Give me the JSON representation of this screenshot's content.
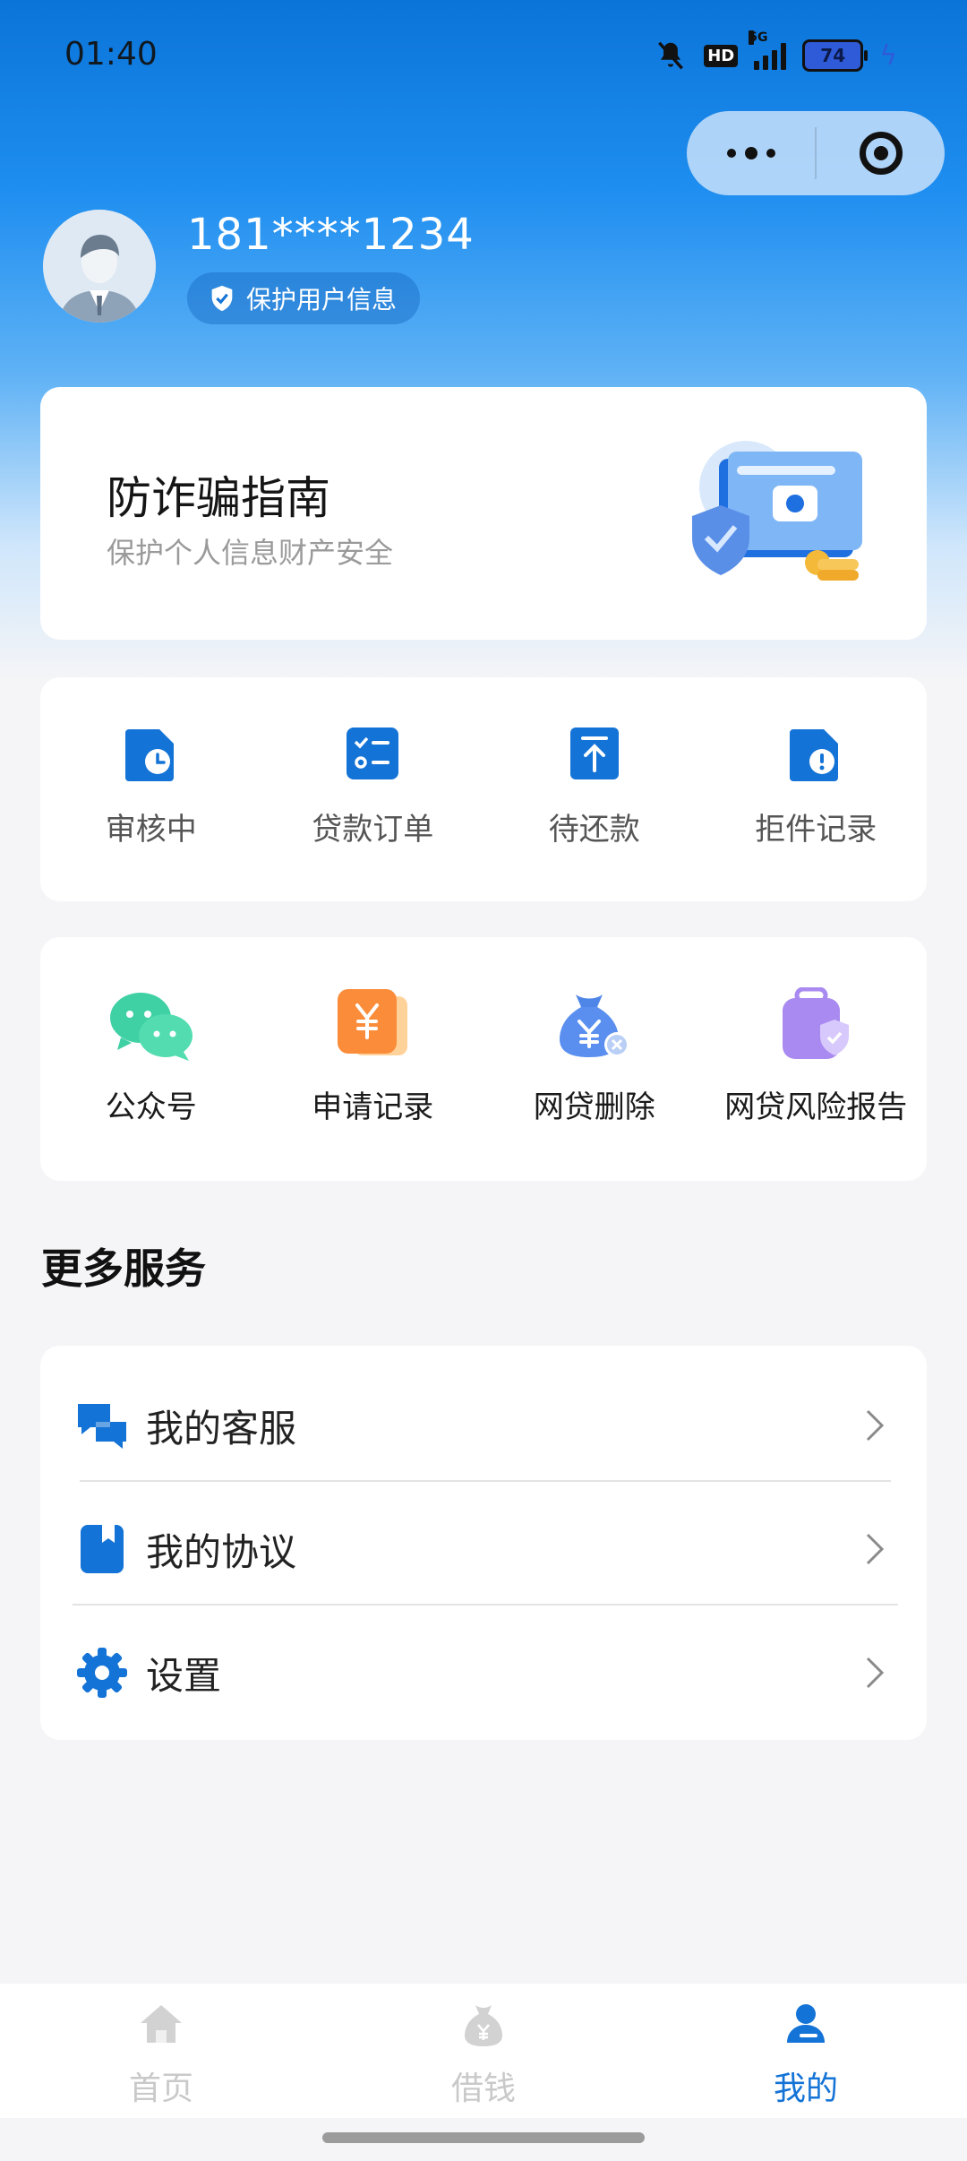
{
  "status_bar": {
    "time": "01:40",
    "network": "5G",
    "hd": "HD",
    "battery": "74"
  },
  "capsule": {
    "more_icon": "more-dots-icon",
    "close_icon": "target-circle-icon"
  },
  "profile": {
    "phone": "181****1234",
    "privacy_badge": "保护用户信息"
  },
  "banner": {
    "title": "防诈骗指南",
    "subtitle": "保护个人信息财产安全"
  },
  "status_grid": [
    {
      "label": "审核中",
      "icon": "clock-document-icon"
    },
    {
      "label": "贷款订单",
      "icon": "checklist-icon"
    },
    {
      "label": "待还款",
      "icon": "repay-upload-icon"
    },
    {
      "label": "拒件记录",
      "icon": "alert-document-icon"
    }
  ],
  "service_grid": [
    {
      "label": "公众号",
      "icon": "wechat-icon"
    },
    {
      "label": "申请记录",
      "icon": "yuan-record-icon"
    },
    {
      "label": "网贷删除",
      "icon": "money-bag-delete-icon"
    },
    {
      "label": "网贷风险报告",
      "icon": "risk-report-icon"
    }
  ],
  "more_services": {
    "title": "更多服务",
    "items": [
      {
        "label": "我的客服",
        "icon": "chat-bubbles-icon"
      },
      {
        "label": "我的协议",
        "icon": "book-icon"
      },
      {
        "label": "设置",
        "icon": "gear-icon"
      }
    ]
  },
  "tabbar": {
    "tabs": [
      {
        "label": "首页",
        "icon": "home-icon",
        "active": false
      },
      {
        "label": "借钱",
        "icon": "money-bag-icon",
        "active": false
      },
      {
        "label": "我的",
        "icon": "user-icon",
        "active": true
      }
    ]
  },
  "colors": {
    "brand_blue": "#1473d6",
    "inactive_tab": "#c9c9c9"
  }
}
